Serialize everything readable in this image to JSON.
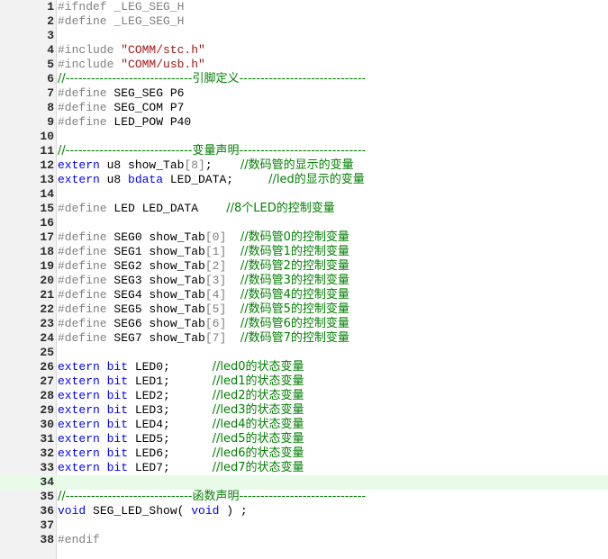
{
  "editor": {
    "current_line": 34,
    "colors": {
      "preprocessor": "#808080",
      "string": "#a31515",
      "comment": "#008000",
      "keyword": "#0000ff",
      "text": "#000000",
      "gutter_background": "#f2f2f2",
      "current_line_background": "#e8fae8"
    },
    "lines": [
      {
        "n": "1",
        "tokens": [
          {
            "t": "pp",
            "v": "#ifndef _LEG_SEG_H"
          }
        ]
      },
      {
        "n": "2",
        "tokens": [
          {
            "t": "pp",
            "v": "#define _LEG_SEG_H"
          }
        ]
      },
      {
        "n": "3",
        "tokens": []
      },
      {
        "n": "4",
        "tokens": [
          {
            "t": "pp",
            "v": "#include "
          },
          {
            "t": "str",
            "v": "\"COMM/stc.h\""
          }
        ]
      },
      {
        "n": "5",
        "tokens": [
          {
            "t": "pp",
            "v": "#include "
          },
          {
            "t": "str",
            "v": "\"COMM/usb.h\""
          }
        ]
      },
      {
        "n": "6",
        "tokens": [
          {
            "t": "cm",
            "v": "//------------------------------引脚定义------------------------------"
          }
        ]
      },
      {
        "n": "7",
        "tokens": [
          {
            "t": "pp",
            "v": "#define "
          },
          {
            "t": "tx",
            "v": "SEG_SEG P6"
          }
        ]
      },
      {
        "n": "8",
        "tokens": [
          {
            "t": "pp",
            "v": "#define "
          },
          {
            "t": "tx",
            "v": "SEG_COM P7"
          }
        ]
      },
      {
        "n": "9",
        "tokens": [
          {
            "t": "pp",
            "v": "#define "
          },
          {
            "t": "tx",
            "v": "LED_POW P40"
          }
        ]
      },
      {
        "n": "10",
        "tokens": []
      },
      {
        "n": "11",
        "tokens": [
          {
            "t": "cm",
            "v": "//------------------------------变量声明------------------------------"
          }
        ]
      },
      {
        "n": "12",
        "tokens": [
          {
            "t": "kw",
            "v": "extern"
          },
          {
            "t": "tx",
            "v": " u8 show_Tab"
          },
          {
            "t": "pp",
            "v": "[8]"
          },
          {
            "t": "tx",
            "v": ";    "
          },
          {
            "t": "cm",
            "v": "//数码管的显示的变量"
          }
        ]
      },
      {
        "n": "13",
        "tokens": [
          {
            "t": "kw",
            "v": "extern"
          },
          {
            "t": "tx",
            "v": " u8 "
          },
          {
            "t": "kw",
            "v": "bdata"
          },
          {
            "t": "tx",
            "v": " LED_DATA;     "
          },
          {
            "t": "cm",
            "v": "//led的显示的变量"
          }
        ]
      },
      {
        "n": "14",
        "tokens": []
      },
      {
        "n": "15",
        "tokens": [
          {
            "t": "pp",
            "v": "#define "
          },
          {
            "t": "tx",
            "v": "LED LED_DATA    "
          },
          {
            "t": "cm",
            "v": "//8个LED的控制变量"
          }
        ]
      },
      {
        "n": "16",
        "tokens": []
      },
      {
        "n": "17",
        "tokens": [
          {
            "t": "pp",
            "v": "#define "
          },
          {
            "t": "tx",
            "v": "SEG0 show_Tab"
          },
          {
            "t": "pp",
            "v": "[0]"
          },
          {
            "t": "tx",
            "v": "  "
          },
          {
            "t": "cm",
            "v": "//数码管0的控制变量"
          }
        ]
      },
      {
        "n": "18",
        "tokens": [
          {
            "t": "pp",
            "v": "#define "
          },
          {
            "t": "tx",
            "v": "SEG1 show_Tab"
          },
          {
            "t": "pp",
            "v": "[1]"
          },
          {
            "t": "tx",
            "v": "  "
          },
          {
            "t": "cm",
            "v": "//数码管1的控制变量"
          }
        ]
      },
      {
        "n": "19",
        "tokens": [
          {
            "t": "pp",
            "v": "#define "
          },
          {
            "t": "tx",
            "v": "SEG2 show_Tab"
          },
          {
            "t": "pp",
            "v": "[2]"
          },
          {
            "t": "tx",
            "v": "  "
          },
          {
            "t": "cm",
            "v": "//数码管2的控制变量"
          }
        ]
      },
      {
        "n": "20",
        "tokens": [
          {
            "t": "pp",
            "v": "#define "
          },
          {
            "t": "tx",
            "v": "SEG3 show_Tab"
          },
          {
            "t": "pp",
            "v": "[3]"
          },
          {
            "t": "tx",
            "v": "  "
          },
          {
            "t": "cm",
            "v": "//数码管3的控制变量"
          }
        ]
      },
      {
        "n": "21",
        "tokens": [
          {
            "t": "pp",
            "v": "#define "
          },
          {
            "t": "tx",
            "v": "SEG4 show_Tab"
          },
          {
            "t": "pp",
            "v": "[4]"
          },
          {
            "t": "tx",
            "v": "  "
          },
          {
            "t": "cm",
            "v": "//数码管4的控制变量"
          }
        ]
      },
      {
        "n": "22",
        "tokens": [
          {
            "t": "pp",
            "v": "#define "
          },
          {
            "t": "tx",
            "v": "SEG5 show_Tab"
          },
          {
            "t": "pp",
            "v": "[5]"
          },
          {
            "t": "tx",
            "v": "  "
          },
          {
            "t": "cm",
            "v": "//数码管5的控制变量"
          }
        ]
      },
      {
        "n": "23",
        "tokens": [
          {
            "t": "pp",
            "v": "#define "
          },
          {
            "t": "tx",
            "v": "SEG6 show_Tab"
          },
          {
            "t": "pp",
            "v": "[6]"
          },
          {
            "t": "tx",
            "v": "  "
          },
          {
            "t": "cm",
            "v": "//数码管6的控制变量"
          }
        ]
      },
      {
        "n": "24",
        "tokens": [
          {
            "t": "pp",
            "v": "#define "
          },
          {
            "t": "tx",
            "v": "SEG7 show_Tab"
          },
          {
            "t": "pp",
            "v": "[7]"
          },
          {
            "t": "tx",
            "v": "  "
          },
          {
            "t": "cm",
            "v": "//数码管7的控制变量"
          }
        ]
      },
      {
        "n": "25",
        "tokens": []
      },
      {
        "n": "26",
        "tokens": [
          {
            "t": "kw",
            "v": "extern"
          },
          {
            "t": "tx",
            "v": " "
          },
          {
            "t": "kw",
            "v": "bit"
          },
          {
            "t": "tx",
            "v": " LED0;      "
          },
          {
            "t": "cm",
            "v": "//led0的状态变量"
          }
        ]
      },
      {
        "n": "27",
        "tokens": [
          {
            "t": "kw",
            "v": "extern"
          },
          {
            "t": "tx",
            "v": " "
          },
          {
            "t": "kw",
            "v": "bit"
          },
          {
            "t": "tx",
            "v": " LED1;      "
          },
          {
            "t": "cm",
            "v": "//led1的状态变量"
          }
        ]
      },
      {
        "n": "28",
        "tokens": [
          {
            "t": "kw",
            "v": "extern"
          },
          {
            "t": "tx",
            "v": " "
          },
          {
            "t": "kw",
            "v": "bit"
          },
          {
            "t": "tx",
            "v": " LED2;      "
          },
          {
            "t": "cm",
            "v": "//led2的状态变量"
          }
        ]
      },
      {
        "n": "29",
        "tokens": [
          {
            "t": "kw",
            "v": "extern"
          },
          {
            "t": "tx",
            "v": " "
          },
          {
            "t": "kw",
            "v": "bit"
          },
          {
            "t": "tx",
            "v": " LED3;      "
          },
          {
            "t": "cm",
            "v": "//led3的状态变量"
          }
        ]
      },
      {
        "n": "30",
        "tokens": [
          {
            "t": "kw",
            "v": "extern"
          },
          {
            "t": "tx",
            "v": " "
          },
          {
            "t": "kw",
            "v": "bit"
          },
          {
            "t": "tx",
            "v": " LED4;      "
          },
          {
            "t": "cm",
            "v": "//led4的状态变量"
          }
        ]
      },
      {
        "n": "31",
        "tokens": [
          {
            "t": "kw",
            "v": "extern"
          },
          {
            "t": "tx",
            "v": " "
          },
          {
            "t": "kw",
            "v": "bit"
          },
          {
            "t": "tx",
            "v": " LED5;      "
          },
          {
            "t": "cm",
            "v": "//led5的状态变量"
          }
        ]
      },
      {
        "n": "32",
        "tokens": [
          {
            "t": "kw",
            "v": "extern"
          },
          {
            "t": "tx",
            "v": " "
          },
          {
            "t": "kw",
            "v": "bit"
          },
          {
            "t": "tx",
            "v": " LED6;      "
          },
          {
            "t": "cm",
            "v": "//led6的状态变量"
          }
        ]
      },
      {
        "n": "33",
        "tokens": [
          {
            "t": "kw",
            "v": "extern"
          },
          {
            "t": "tx",
            "v": " "
          },
          {
            "t": "kw",
            "v": "bit"
          },
          {
            "t": "tx",
            "v": " LED7;      "
          },
          {
            "t": "cm",
            "v": "//led7的状态变量"
          }
        ]
      },
      {
        "n": "34",
        "tokens": []
      },
      {
        "n": "35",
        "tokens": [
          {
            "t": "cm",
            "v": "//------------------------------函数声明------------------------------"
          }
        ]
      },
      {
        "n": "36",
        "tokens": [
          {
            "t": "kw",
            "v": "void"
          },
          {
            "t": "tx",
            "v": " SEG_LED_Show( "
          },
          {
            "t": "kw",
            "v": "void"
          },
          {
            "t": "tx",
            "v": " ) ;"
          }
        ]
      },
      {
        "n": "37",
        "tokens": []
      },
      {
        "n": "38",
        "tokens": [
          {
            "t": "pp",
            "v": "#endif"
          }
        ]
      }
    ]
  }
}
